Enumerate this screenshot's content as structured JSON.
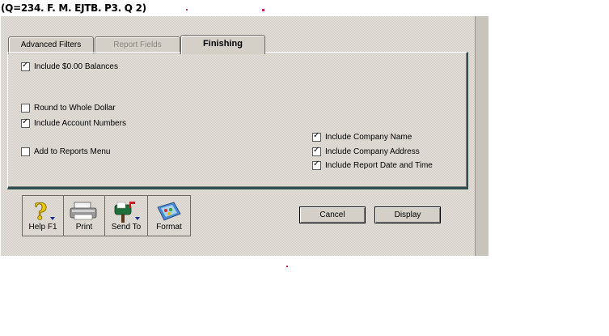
{
  "caption": "(Q=234. F. M. EJTB. P3. Q 2)",
  "tabs": {
    "advanced_filters": "Advanced Filters",
    "report_fields": "Report Fields",
    "finishing": "Finishing"
  },
  "options": {
    "include_zero_balances": {
      "label": "Include $0.00 Balances",
      "checked": true
    },
    "round_whole_dollar": {
      "label": "Round to Whole Dollar",
      "checked": false
    },
    "include_account_numbers": {
      "label": "Include Account Numbers",
      "checked": true
    },
    "add_to_reports_menu": {
      "label": "Add to Reports Menu",
      "checked": false
    },
    "include_company_name": {
      "label": "Include Company Name",
      "checked": true
    },
    "include_company_address": {
      "label": "Include Company Address",
      "checked": true
    },
    "include_report_date_time": {
      "label": "Include Report Date and Time",
      "checked": true
    }
  },
  "toolbar": {
    "help": "Help F1",
    "print": "Print",
    "send_to": "Send To",
    "format": "Format"
  },
  "buttons": {
    "cancel": "Cancel",
    "display": "Display"
  },
  "colors": {
    "dialog_bg": "#d4d0c8",
    "panel_border": "#2f4f4f"
  }
}
